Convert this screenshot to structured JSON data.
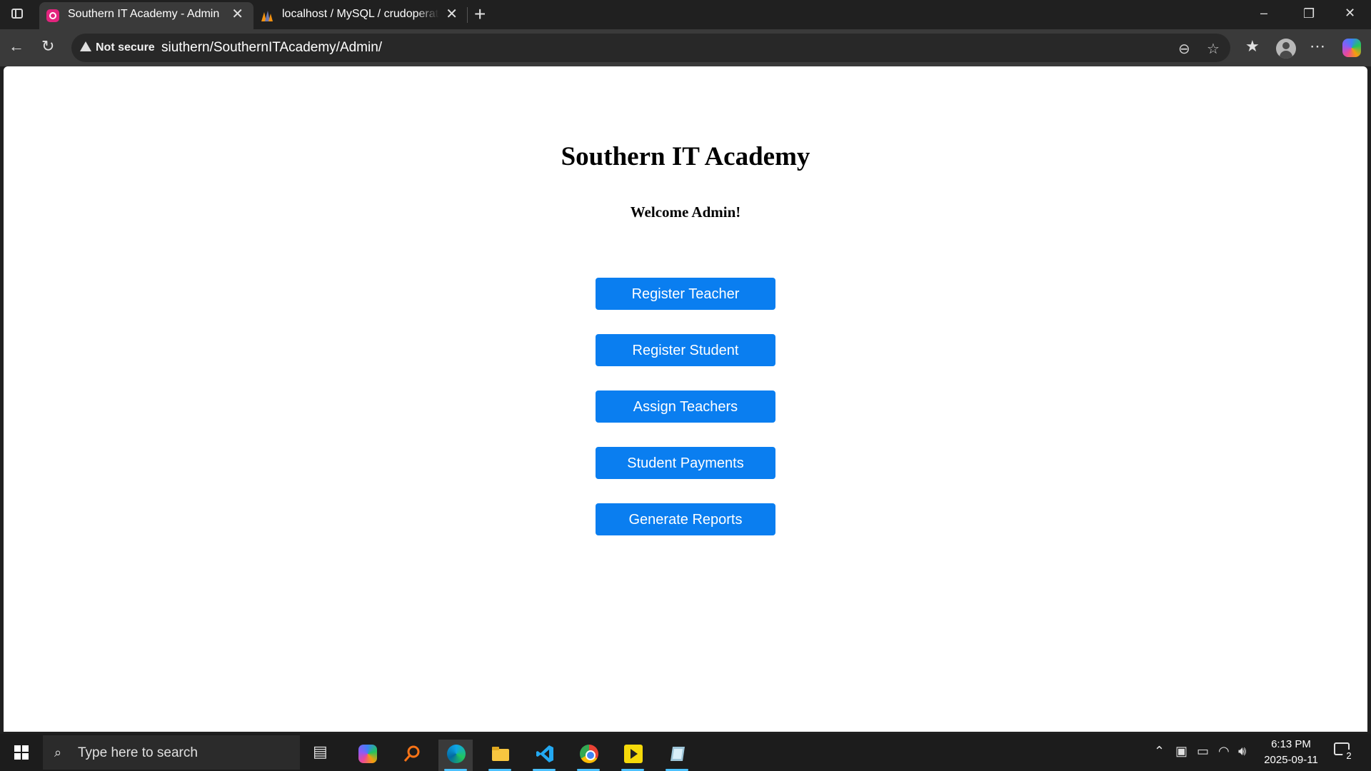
{
  "browser": {
    "tabs": [
      {
        "title": "Southern IT Academy - Admin",
        "active": true
      },
      {
        "title": "localhost / MySQL / crudoperations",
        "active": false
      }
    ],
    "address_bar": {
      "security_label": "Not secure",
      "url": "siuthern/SouthernITAcademy/Admin/"
    }
  },
  "page": {
    "title": "Southern IT Academy",
    "welcome": "Welcome Admin!",
    "buttons": [
      {
        "label": "Register Teacher"
      },
      {
        "label": "Register Student"
      },
      {
        "label": "Assign Teachers"
      },
      {
        "label": "Student Payments"
      },
      {
        "label": "Generate Reports"
      }
    ],
    "button_color": "#0a7ef0"
  },
  "taskbar": {
    "search_placeholder": "Type here to search",
    "clock": {
      "time": "6:13 PM",
      "date": "2025-09-11"
    },
    "notification_count": "2",
    "apps": [
      "copilot-icon",
      "search-app-icon",
      "edge-icon",
      "file-explorer-icon",
      "vscode-icon",
      "chrome-icon",
      "player-icon",
      "notes-icon"
    ]
  }
}
